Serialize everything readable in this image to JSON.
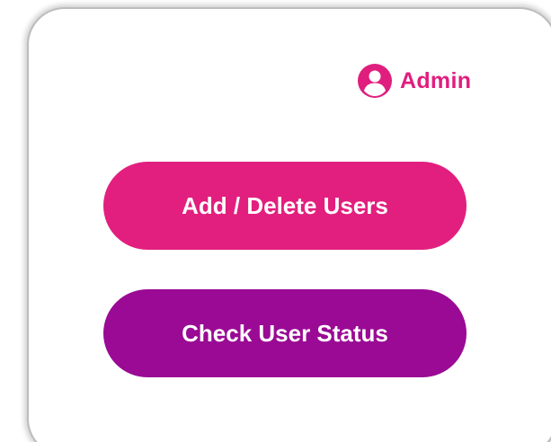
{
  "header": {
    "user_label": "Admin",
    "user_icon": "user-circle-icon"
  },
  "actions": {
    "add_delete_users_label": "Add / Delete Users",
    "check_user_status_label": "Check User Status"
  },
  "colors": {
    "accent_pink": "#e01e7e",
    "button_add": "#e21f7e",
    "button_check": "#9a0a94",
    "card_border": "#bdbdbd",
    "text_on_button": "#ffffff"
  }
}
